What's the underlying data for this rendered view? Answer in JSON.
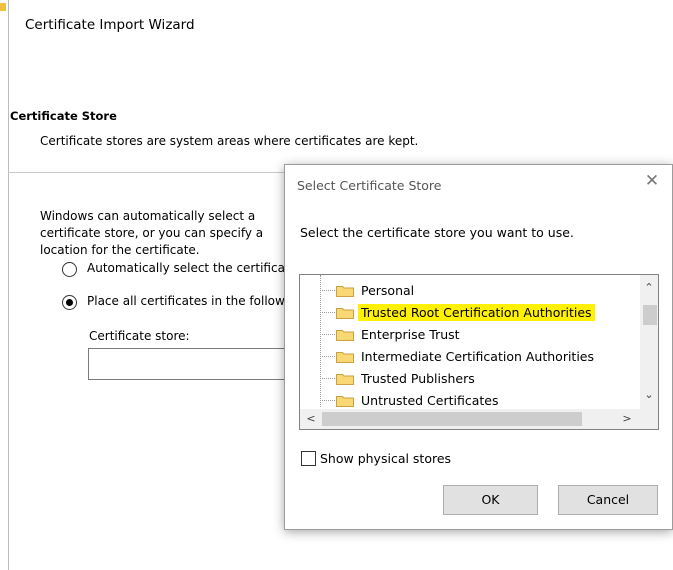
{
  "wizard": {
    "title": "Certificate Import Wizard",
    "section_heading": "Certificate Store",
    "section_desc": "Certificate stores are system areas where certificates are kept.",
    "intro_text": "Windows can automatically select a certificate store, or you can specify a location for the certificate.",
    "radio_auto_label": "Automatically select the certificate store based on the type of certificate",
    "radio_place_label": "Place all certificates in the following store",
    "store_label": "Certificate store:",
    "store_value": ""
  },
  "dialog": {
    "title": "Select Certificate Store",
    "close_glyph": "✕",
    "instruction": "Select the certificate store you want to use.",
    "stores": [
      {
        "label": "Personal",
        "selected": false
      },
      {
        "label": "Trusted Root Certification Authorities",
        "selected": true
      },
      {
        "label": "Enterprise Trust",
        "selected": false
      },
      {
        "label": "Intermediate Certification Authorities",
        "selected": false
      },
      {
        "label": "Trusted Publishers",
        "selected": false
      },
      {
        "label": "Untrusted Certificates",
        "selected": false
      }
    ],
    "scroll_up": "⌃",
    "scroll_down": "⌄",
    "scroll_left": "<",
    "scroll_right": ">",
    "show_physical_label": "Show physical stores",
    "show_physical_checked": false,
    "ok_label": "OK",
    "cancel_label": "Cancel"
  },
  "colors": {
    "selection_highlight": "#fff100",
    "folder": "#f8d775"
  }
}
